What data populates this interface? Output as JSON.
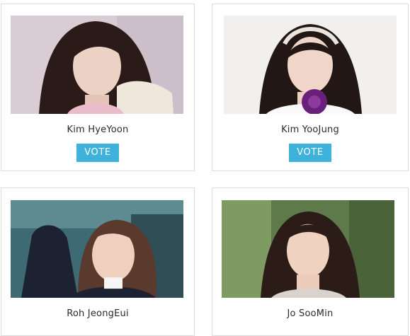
{
  "accent_color": "#3fb2db",
  "cards": [
    {
      "name": "Kim HyeYoon",
      "vote_label": "VOTE",
      "photo": "portrait-photo"
    },
    {
      "name": "Kim YooJung",
      "vote_label": "VOTE",
      "photo": "portrait-photo"
    },
    {
      "name": "Roh JeongEui",
      "photo": "portrait-photo"
    },
    {
      "name": "Jo SooMin",
      "photo": "portrait-photo"
    }
  ]
}
